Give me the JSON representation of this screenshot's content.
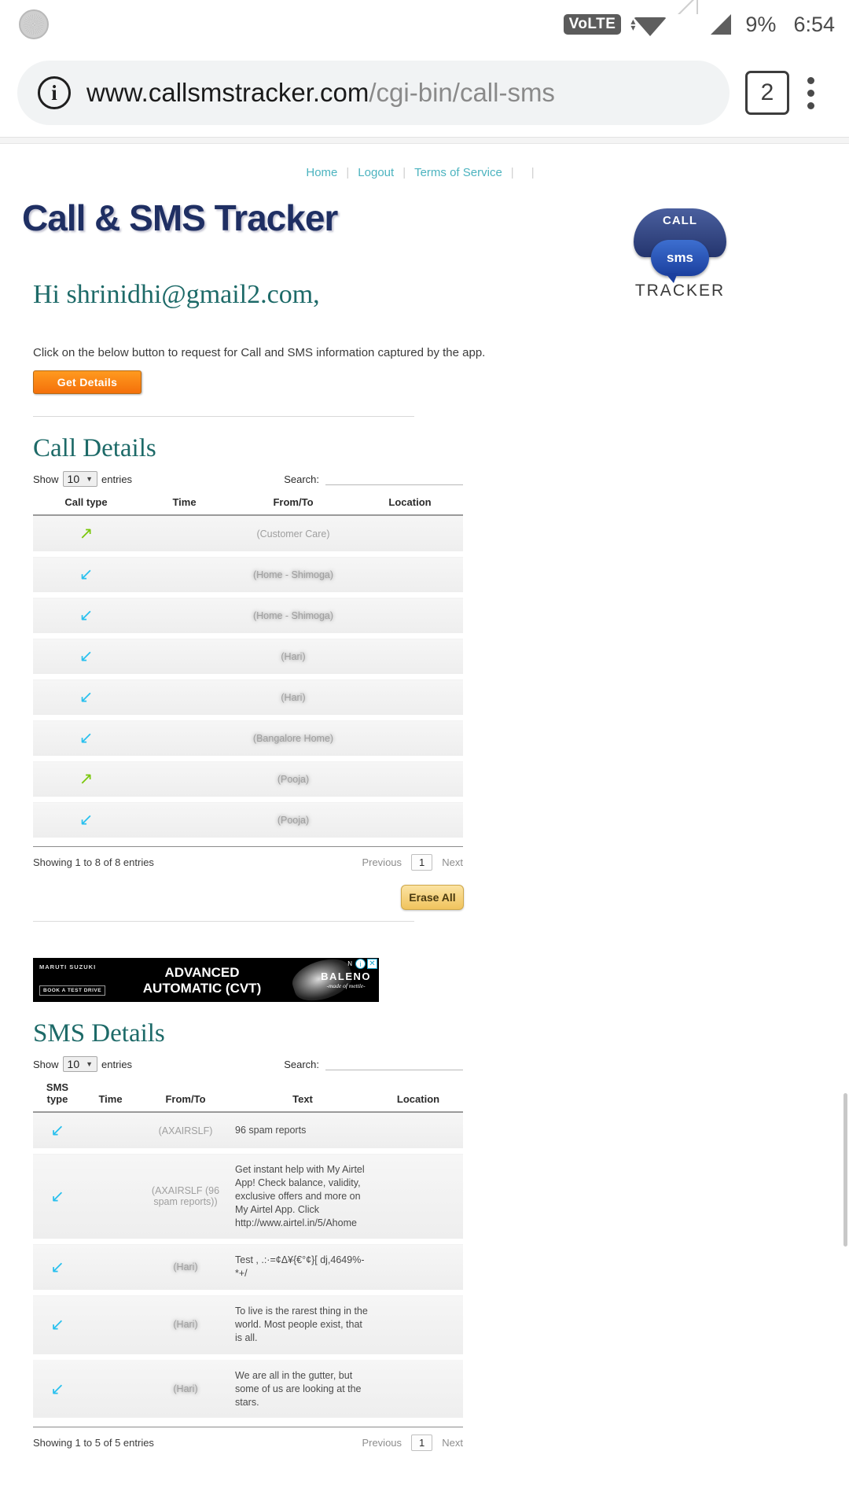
{
  "statusbar": {
    "volte_label": "VoLTE",
    "battery": "9%",
    "clock": "6:54"
  },
  "browser": {
    "url_host": "www.callsmstracker.com",
    "url_path": "/cgi-bin/call-sms",
    "tab_count": "2",
    "info_icon": "i"
  },
  "topnav": {
    "items": [
      {
        "label": "Home"
      },
      {
        "label": "Logout"
      },
      {
        "label": "Terms of Service"
      }
    ]
  },
  "brand": {
    "logo_text": "Call & SMS Tracker",
    "mark_call": "CALL",
    "mark_sms": "sms",
    "mark_tracker": "TRACKER"
  },
  "account": {
    "greeting": "Hi shrinidhi@gmail2.com,",
    "hint": "Click on the below button to request for Call and SMS information captured by the app.",
    "get_details_label": "Get Details"
  },
  "call_section": {
    "title": "Call Details",
    "show_label": "Show",
    "entries_label": "entries",
    "page_length": "10",
    "search_label": "Search:",
    "search_value": "",
    "columns": [
      "Call type",
      "Time",
      "From/To",
      "Location"
    ],
    "rows": [
      {
        "type": "out",
        "time": "",
        "from_to": "(Customer Care)",
        "location": "",
        "redacted": false
      },
      {
        "type": "in",
        "time": "",
        "from_to": "(Home - Shimoga)",
        "location": "",
        "redacted": true
      },
      {
        "type": "in",
        "time": "",
        "from_to": "(Home - Shimoga)",
        "location": "",
        "redacted": true
      },
      {
        "type": "in",
        "time": "",
        "from_to": "(Hari)",
        "location": "",
        "redacted": true
      },
      {
        "type": "in",
        "time": "",
        "from_to": "(Hari)",
        "location": "",
        "redacted": true
      },
      {
        "type": "in",
        "time": "",
        "from_to": "(Bangalore Home)",
        "location": "",
        "redacted": true
      },
      {
        "type": "out",
        "time": "",
        "from_to": "(Pooja)",
        "location": "",
        "redacted": true
      },
      {
        "type": "in",
        "time": "",
        "from_to": "(Pooja)",
        "location": "",
        "redacted": true
      }
    ],
    "info": "Showing 1 to 8 of 8 entries",
    "previous_label": "Previous",
    "page_number": "1",
    "next_label": "Next",
    "erase_label": "Erase All"
  },
  "ad": {
    "brand": "MARUTI SUZUKI",
    "cta": "BOOK A TEST DRIVE",
    "headline_line1": "ADVANCED",
    "headline_line2": "AUTOMATIC (CVT)",
    "product": "BALENO",
    "tagline": "-made of mettle-",
    "badge_n": "N",
    "badge_info": "i",
    "badge_close": "✕"
  },
  "sms_section": {
    "title": "SMS Details",
    "show_label": "Show",
    "entries_label": "entries",
    "page_length": "10",
    "search_label": "Search:",
    "search_value": "",
    "columns": [
      "SMS type",
      "Time",
      "From/To",
      "Text",
      "Location"
    ],
    "rows": [
      {
        "type": "in",
        "time": "",
        "from_to": "(AXAIRSLF)",
        "text": "96 spam reports",
        "location": "",
        "redacted": false
      },
      {
        "type": "in",
        "time": "",
        "from_to": "(AXAIRSLF (96 spam reports))",
        "text": "Get instant help with My Airtel App! Check balance, validity, exclusive offers and more on My Airtel App. Click http://www.airtel.in/5/Ahome",
        "location": "",
        "redacted": false
      },
      {
        "type": "in",
        "time": "",
        "from_to": "(Hari)",
        "text": "Test , .:·=¢Δ¥{€°¢}[ dj,4649%-*+/",
        "location": "",
        "redacted": true
      },
      {
        "type": "in",
        "time": "",
        "from_to": "(Hari)",
        "text": "To live is the rarest thing in the world. Most people exist, that is all.",
        "location": "",
        "redacted": true
      },
      {
        "type": "in",
        "time": "",
        "from_to": "(Hari)",
        "text": "We are all in the gutter, but some of us are looking at the stars.",
        "location": "",
        "redacted": true
      }
    ],
    "info": "Showing 1 to 5 of 5 entries",
    "previous_label": "Previous",
    "page_number": "1",
    "next_label": "Next"
  },
  "icons": {
    "outgoing_call": "↗",
    "incoming_call": "↙",
    "caret_down": "▼"
  },
  "colors": {
    "accent_teal": "#1d6a68",
    "link": "#4bb3bf",
    "outgoing_green": "#7ac70c",
    "incoming_blue": "#29c0ee",
    "button_orange": "#f4700a"
  }
}
